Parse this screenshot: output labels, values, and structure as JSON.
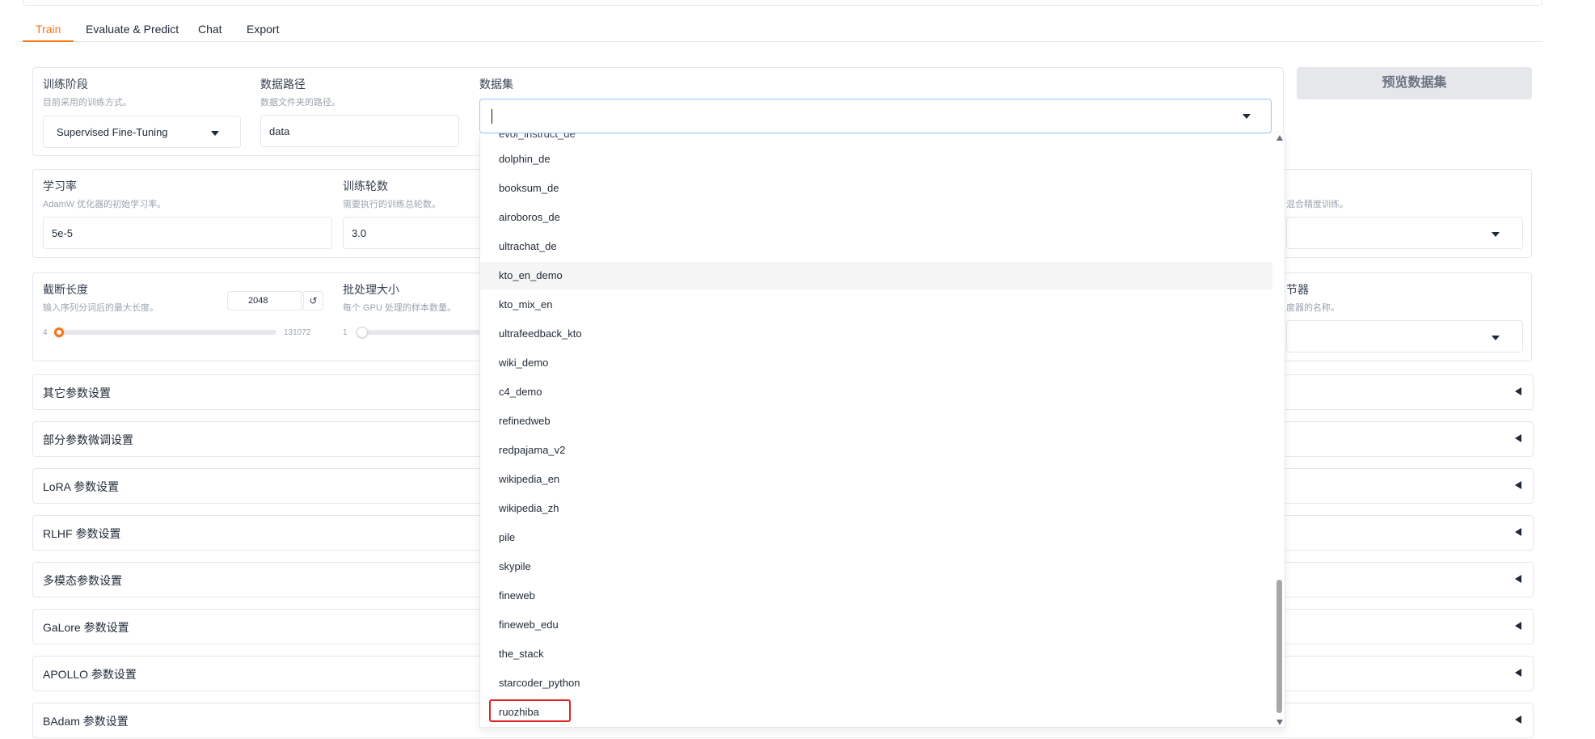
{
  "tabs": [
    "Train",
    "Evaluate & Predict",
    "Chat",
    "Export"
  ],
  "train": {
    "stage": {
      "label": "训练阶段",
      "info": "目前采用的训练方式。",
      "value": "Supervised Fine-Tuning"
    },
    "dataset_dir": {
      "label": "数据路径",
      "info": "数据文件夹的路径。",
      "value": "data"
    },
    "dataset": {
      "label": "数据集",
      "value": ""
    },
    "preview_button": "预览数据集"
  },
  "params": {
    "learning_rate": {
      "label": "学习率",
      "info": "AdamW 优化器的初始学习率。",
      "value": "5e-5"
    },
    "num_epochs": {
      "label": "训练轮数",
      "info": "需要执行的训练总轮数。",
      "value": "3.0"
    },
    "compute_type_info": "混合精度训练。",
    "cutoff_len": {
      "label": "截断长度",
      "info": "输入序列分词后的最大长度。",
      "value": "2048",
      "min": "4",
      "max": "131072",
      "reset_icon": "↺",
      "fraction": 0.016
    },
    "batch_size": {
      "label": "批处理大小",
      "info": "每个 GPU 处理的样本数量。",
      "min": "1",
      "fraction": 0.0
    },
    "lr_scheduler": {
      "label": "节器",
      "info": "度器的名称。"
    }
  },
  "accordions": [
    "其它参数设置",
    "部分参数微调设置",
    "LoRA 参数设置",
    "RLHF 参数设置",
    "多模态参数设置",
    "GaLore 参数设置",
    "APOLLO 参数设置",
    "BAdam 参数设置"
  ],
  "dropdown": {
    "partial_top": "evol_instruct_de",
    "options": [
      "dolphin_de",
      "booksum_de",
      "airoboros_de",
      "ultrachat_de",
      "kto_en_demo",
      "kto_mix_en",
      "ultrafeedback_kto",
      "wiki_demo",
      "c4_demo",
      "refinedweb",
      "redpajama_v2",
      "wikipedia_en",
      "wikipedia_zh",
      "pile",
      "skypile",
      "fineweb",
      "fineweb_edu",
      "the_stack",
      "starcoder_python",
      "ruozhiba"
    ],
    "hovered": "kto_en_demo",
    "highlighted": "ruozhiba"
  },
  "colors": {
    "accent": "#f97316",
    "highlight_border": "#e02424"
  }
}
